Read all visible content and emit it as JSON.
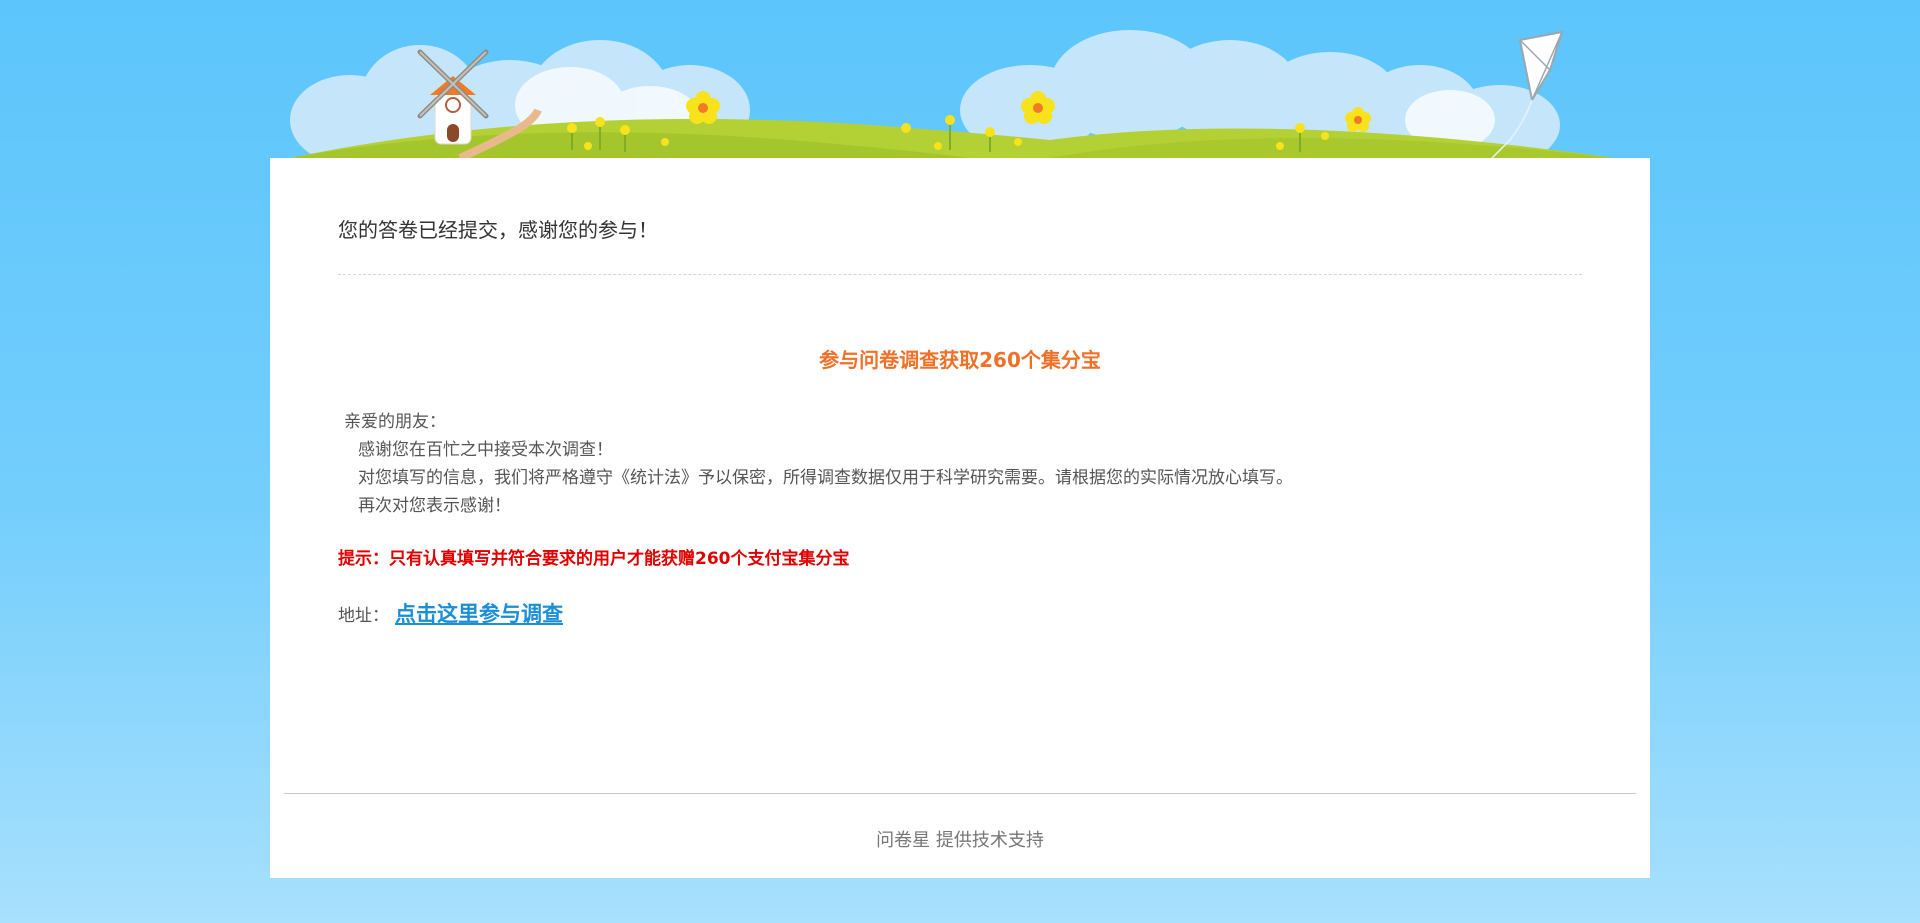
{
  "message": {
    "title": "您的答卷已经提交，感谢您的参与！"
  },
  "promo": {
    "title": "参与问卷调查获取260个集分宝",
    "greeting": "亲爱的朋友：",
    "lines": [
      "感谢您在百忙之中接受本次调查！",
      "对您填写的信息，我们将严格遵守《统计法》予以保密，所得调查数据仅用于科学研究需要。请根据您的实际情况放心填写。",
      "再次对您表示感谢！"
    ],
    "tip": "提示：只有认真填写并符合要求的用户才能获赠260个支付宝集分宝",
    "address_label": "地址：",
    "link_text": "点击这里参与调查"
  },
  "footer": {
    "text": "问卷星 提供技术支持"
  },
  "colors": {
    "background": "#5cc5fb",
    "promo_title": "#f07028",
    "tip": "#e00000",
    "link": "#1a8ed6"
  },
  "icons": [
    "windmill-icon",
    "kite-icon",
    "flower-icon",
    "cloud-icon"
  ]
}
